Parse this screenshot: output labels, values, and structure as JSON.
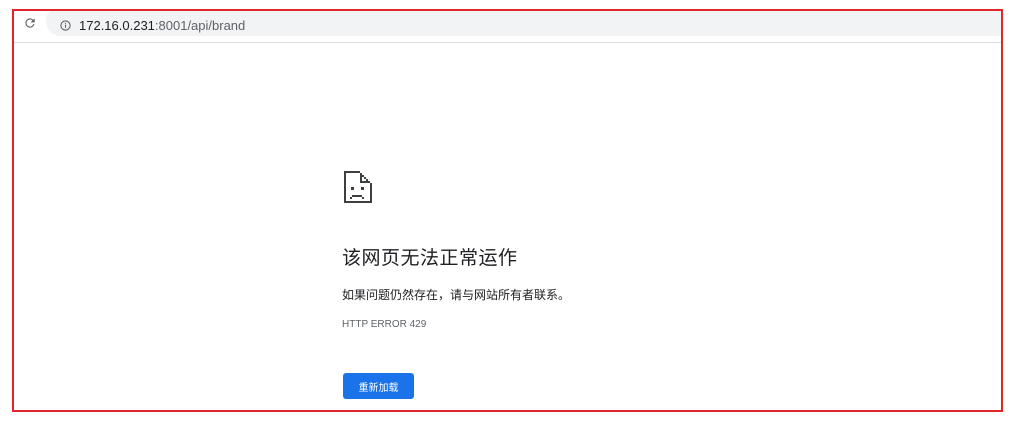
{
  "toolbar": {
    "reload_icon": "reload-icon",
    "info_icon": "info-icon",
    "url_host": "172.16.0.231",
    "url_rest": ":8001/api/brand"
  },
  "error": {
    "icon": "sad-page-icon",
    "heading": "该网页无法正常运作",
    "message": "如果问题仍然存在，请与网站所有者联系。",
    "code": "HTTP ERROR 429",
    "reload_button_label": "重新加载"
  },
  "colors": {
    "frame_border": "#e0252b",
    "button_bg": "#1a73e8",
    "omnibox_bg": "#f1f3f4",
    "text": "#202124",
    "secondary_text": "#5f6368"
  }
}
